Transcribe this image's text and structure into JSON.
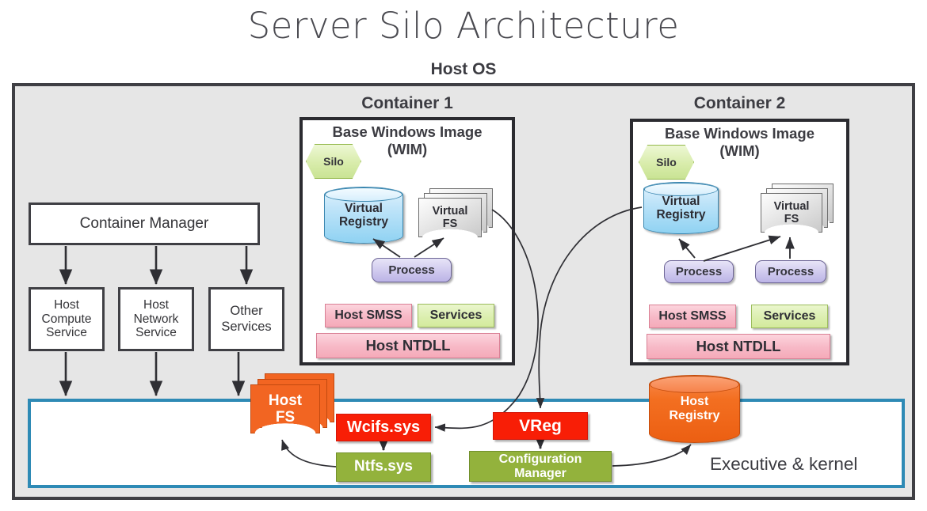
{
  "title": "Server Silo Architecture",
  "host_os": {
    "label": "Host OS"
  },
  "left_column": {
    "manager": {
      "label": "Container Manager"
    },
    "services": [
      {
        "label": "Host\nCompute\nService",
        "name": "host-compute-service"
      },
      {
        "label": "Host\nNetwork\nService",
        "name": "host-network-service"
      },
      {
        "label": "Other\nServices",
        "name": "other-services"
      }
    ]
  },
  "containers": [
    {
      "title": "Container 1",
      "wim_title_line1": "Base Windows Image",
      "wim_title_line2": "(WIM)",
      "silo": "Silo",
      "virtual_registry": "Virtual\nRegistry",
      "virtual_fs": "Virtual\nFS",
      "processes": [
        "Process"
      ],
      "host_smss": "Host SMSS",
      "services": "Services",
      "host_ntdll": "Host NTDLL"
    },
    {
      "title": "Container 2",
      "wim_title_line1": "Base Windows Image",
      "wim_title_line2": "(WIM)",
      "silo": "Silo",
      "virtual_registry": "Virtual\nRegistry",
      "virtual_fs": "Virtual\nFS",
      "processes": [
        "Process",
        "Process"
      ],
      "host_smss": "Host SMSS",
      "services": "Services",
      "host_ntdll": "Host NTDLL"
    }
  ],
  "kernel": {
    "label": "Executive & kernel",
    "host_fs": "Host\nFS",
    "host_registry": "Host\nRegistry",
    "wcifs": "Wcifs.sys",
    "ntfs": "Ntfs.sys",
    "vreg": "VReg",
    "config_manager": "Configuration\nManager"
  },
  "colors": {
    "host_os_fill": "#e6e6e6",
    "host_os_border": "#3f3f44",
    "kernel_border": "#2e8ab5",
    "red_driver": "#f81e06",
    "olive_driver": "#93b23c",
    "orange_fs": "#f26522",
    "silo_green": "#d8ecab",
    "registry_blue": "#bfe4f9",
    "process_purple": "#cfc9ee",
    "pink_box": "#f7b8c6",
    "green_box": "#dcefb0"
  }
}
